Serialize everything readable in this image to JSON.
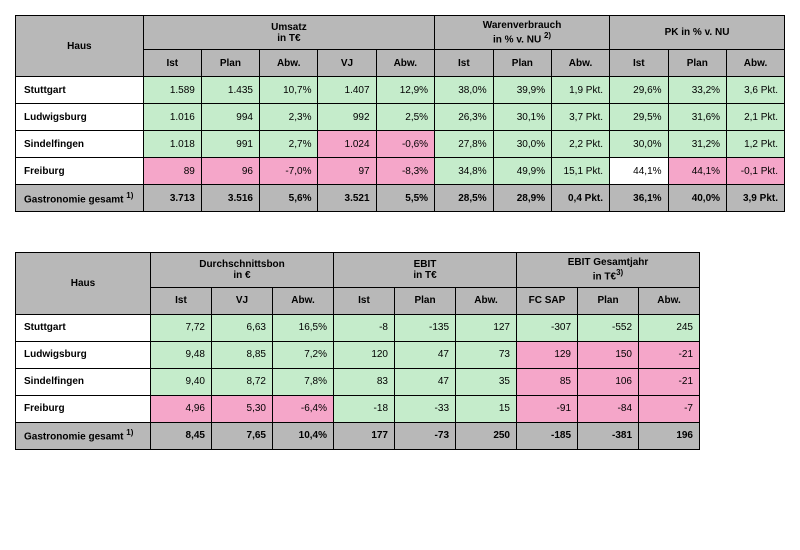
{
  "chart_data": [
    {
      "type": "table",
      "title": "Haus — Umsatz / Warenverbrauch / PK",
      "headers": {
        "haus": "Haus",
        "umsatz": "Umsatz\nin T€",
        "warenverbrauch": "Warenverbrauch\nin % v. NU",
        "pk": "PK in % v. NU",
        "sub": [
          "Ist",
          "Plan",
          "Abw.",
          "VJ",
          "Abw.",
          "Ist",
          "Plan",
          "Abw.",
          "Ist",
          "Plan",
          "Abw."
        ]
      }
    },
    {
      "type": "table",
      "title": "Haus — Durchschnittsbon / EBIT / EBIT Gesamtjahr",
      "headers": {
        "haus": "Haus",
        "dbon": "Durchschnittsbon\nin €",
        "ebit": "EBIT\nin T€",
        "ebitgj": "EBIT Gesamtjahr\nin T€",
        "sub": [
          "Ist",
          "VJ",
          "Abw.",
          "Ist",
          "Plan",
          "Abw.",
          "FC SAP",
          "Plan",
          "Abw."
        ]
      }
    }
  ],
  "t1": {
    "h_haus": "Haus",
    "h_umsatz_l1": "Umsatz",
    "h_umsatz_l2": "in T€",
    "h_waren_l1": "Warenverbrauch",
    "h_waren_l2": "in % v. NU ",
    "h_waren_sup": "2)",
    "h_pk": "PK in % v. NU",
    "sh_ist": "Ist",
    "sh_plan": "Plan",
    "sh_abw": "Abw.",
    "sh_vj": "VJ",
    "rows": [
      {
        "name": "Stuttgart",
        "c": [
          {
            "v": "1.589",
            "k": "g"
          },
          {
            "v": "1.435",
            "k": "g"
          },
          {
            "v": "10,7%",
            "k": "g"
          },
          {
            "v": "1.407",
            "k": "g"
          },
          {
            "v": "12,9%",
            "k": "g"
          },
          {
            "v": "38,0%",
            "k": "g"
          },
          {
            "v": "39,9%",
            "k": "g"
          },
          {
            "v": "1,9 Pkt.",
            "k": "g"
          },
          {
            "v": "29,6%",
            "k": "g"
          },
          {
            "v": "33,2%",
            "k": "g"
          },
          {
            "v": "3,6 Pkt.",
            "k": "g"
          }
        ]
      },
      {
        "name": "Ludwigsburg",
        "c": [
          {
            "v": "1.016",
            "k": "g"
          },
          {
            "v": "994",
            "k": "g"
          },
          {
            "v": "2,3%",
            "k": "g"
          },
          {
            "v": "992",
            "k": "g"
          },
          {
            "v": "2,5%",
            "k": "g"
          },
          {
            "v": "26,3%",
            "k": "g"
          },
          {
            "v": "30,1%",
            "k": "g"
          },
          {
            "v": "3,7 Pkt.",
            "k": "g"
          },
          {
            "v": "29,5%",
            "k": "g"
          },
          {
            "v": "31,6%",
            "k": "g"
          },
          {
            "v": "2,1 Pkt.",
            "k": "g"
          }
        ]
      },
      {
        "name": "Sindelfingen",
        "c": [
          {
            "v": "1.018",
            "k": "g"
          },
          {
            "v": "991",
            "k": "g"
          },
          {
            "v": "2,7%",
            "k": "g"
          },
          {
            "v": "1.024",
            "k": "p"
          },
          {
            "v": "-0,6%",
            "k": "p"
          },
          {
            "v": "27,8%",
            "k": "g"
          },
          {
            "v": "30,0%",
            "k": "g"
          },
          {
            "v": "2,2 Pkt.",
            "k": "g"
          },
          {
            "v": "30,0%",
            "k": "g"
          },
          {
            "v": "31,2%",
            "k": "g"
          },
          {
            "v": "1,2 Pkt.",
            "k": "g"
          }
        ]
      },
      {
        "name": "Freiburg",
        "c": [
          {
            "v": "89",
            "k": "p"
          },
          {
            "v": "96",
            "k": "p"
          },
          {
            "v": "-7,0%",
            "k": "p"
          },
          {
            "v": "97",
            "k": "p"
          },
          {
            "v": "-8,3%",
            "k": "p"
          },
          {
            "v": "34,8%",
            "k": "g"
          },
          {
            "v": "49,9%",
            "k": "g"
          },
          {
            "v": "15,1 Pkt.",
            "k": "g"
          },
          {
            "v": "44,1%",
            "k": "w"
          },
          {
            "v": "44,1%",
            "k": "p"
          },
          {
            "v": "-0,1 Pkt.",
            "k": "p"
          }
        ]
      }
    ],
    "total": {
      "name": "Gastronomie gesamt  ",
      "sup": "1)",
      "c": [
        {
          "v": "3.713",
          "k": ""
        },
        {
          "v": "3.516",
          "k": ""
        },
        {
          "v": "5,6%",
          "k": "g"
        },
        {
          "v": "3.521",
          "k": ""
        },
        {
          "v": "5,5%",
          "k": "g"
        },
        {
          "v": "28,5%",
          "k": ""
        },
        {
          "v": "28,9%",
          "k": ""
        },
        {
          "v": "0,4 Pkt.",
          "k": "g"
        },
        {
          "v": "36,1%",
          "k": ""
        },
        {
          "v": "40,0%",
          "k": ""
        },
        {
          "v": "3,9 Pkt.",
          "k": "g"
        }
      ]
    }
  },
  "t2": {
    "h_haus": "Haus",
    "h_dbon_l1": "Durchschnittsbon",
    "h_dbon_l2": "in €",
    "h_ebit_l1": "EBIT",
    "h_ebit_l2": "in T€",
    "h_ebitgj_l1": "EBIT Gesamtjahr",
    "h_ebitgj_l2": "in T€",
    "h_ebitgj_sup": "3)",
    "sh_ist": "Ist",
    "sh_vj": "VJ",
    "sh_abw": "Abw.",
    "sh_plan": "Plan",
    "sh_fcsap": "FC SAP",
    "rows": [
      {
        "name": "Stuttgart",
        "c": [
          {
            "v": "7,72",
            "k": "g"
          },
          {
            "v": "6,63",
            "k": "g"
          },
          {
            "v": "16,5%",
            "k": "g"
          },
          {
            "v": "-8",
            "k": "g"
          },
          {
            "v": "-135",
            "k": "g"
          },
          {
            "v": "127",
            "k": "g"
          },
          {
            "v": "-307",
            "k": "g"
          },
          {
            "v": "-552",
            "k": "g"
          },
          {
            "v": "245",
            "k": "g"
          }
        ]
      },
      {
        "name": "Ludwigsburg",
        "c": [
          {
            "v": "9,48",
            "k": "g"
          },
          {
            "v": "8,85",
            "k": "g"
          },
          {
            "v": "7,2%",
            "k": "g"
          },
          {
            "v": "120",
            "k": "g"
          },
          {
            "v": "47",
            "k": "g"
          },
          {
            "v": "73",
            "k": "g"
          },
          {
            "v": "129",
            "k": "p"
          },
          {
            "v": "150",
            "k": "p"
          },
          {
            "v": "-21",
            "k": "p"
          }
        ]
      },
      {
        "name": "Sindelfingen",
        "c": [
          {
            "v": "9,40",
            "k": "g"
          },
          {
            "v": "8,72",
            "k": "g"
          },
          {
            "v": "7,8%",
            "k": "g"
          },
          {
            "v": "83",
            "k": "g"
          },
          {
            "v": "47",
            "k": "g"
          },
          {
            "v": "35",
            "k": "g"
          },
          {
            "v": "85",
            "k": "p"
          },
          {
            "v": "106",
            "k": "p"
          },
          {
            "v": "-21",
            "k": "p"
          }
        ]
      },
      {
        "name": "Freiburg",
        "c": [
          {
            "v": "4,96",
            "k": "p"
          },
          {
            "v": "5,30",
            "k": "p"
          },
          {
            "v": "-6,4%",
            "k": "p"
          },
          {
            "v": "-18",
            "k": "g"
          },
          {
            "v": "-33",
            "k": "g"
          },
          {
            "v": "15",
            "k": "g"
          },
          {
            "v": "-91",
            "k": "p"
          },
          {
            "v": "-84",
            "k": "p"
          },
          {
            "v": "-7",
            "k": "p"
          }
        ]
      }
    ],
    "total": {
      "name": "Gastronomie gesamt  ",
      "sup": "1)",
      "c": [
        {
          "v": "8,45",
          "k": ""
        },
        {
          "v": "7,65",
          "k": ""
        },
        {
          "v": "10,4%",
          "k": "g"
        },
        {
          "v": "177",
          "k": ""
        },
        {
          "v": "-73",
          "k": ""
        },
        {
          "v": "250",
          "k": "g"
        },
        {
          "v": "-185",
          "k": ""
        },
        {
          "v": "-381",
          "k": ""
        },
        {
          "v": "196",
          "k": "g"
        }
      ]
    }
  }
}
